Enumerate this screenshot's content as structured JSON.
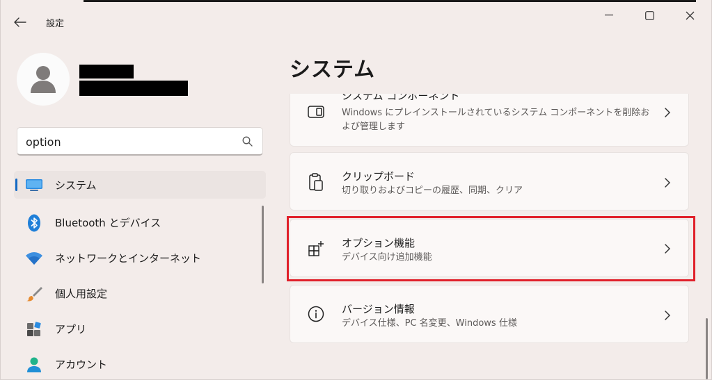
{
  "titlebar": {
    "title": "設定"
  },
  "search": {
    "value": "option"
  },
  "sidebar": {
    "items": [
      {
        "label": "システム"
      },
      {
        "label": "Bluetooth とデバイス"
      },
      {
        "label": "ネットワークとインターネット"
      },
      {
        "label": "個人用設定"
      },
      {
        "label": "アプリ"
      },
      {
        "label": "アカウント"
      }
    ]
  },
  "main": {
    "title": "システム",
    "cards": [
      {
        "title": "システム コンポーネント",
        "subtitle": "Windows にプレインストールされているシステム コンポーネントを削除および管理します"
      },
      {
        "title": "クリップボード",
        "subtitle": "切り取りおよびコピーの履歴、同期、クリア"
      },
      {
        "title": "オプション機能",
        "subtitle": "デバイス向け追加機能"
      },
      {
        "title": "バージョン情報",
        "subtitle": "デバイス仕様、PC 名変更、Windows 仕様"
      }
    ]
  },
  "colors": {
    "background": "#f3ecea",
    "accent": "#1368c4",
    "highlight": "#e0202a"
  }
}
